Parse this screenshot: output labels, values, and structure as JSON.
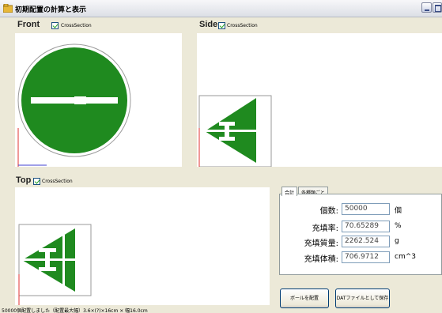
{
  "window": {
    "title": "初期配置の計算と表示"
  },
  "views": {
    "front": {
      "label": "Front",
      "checkbox_label": "CrossSection"
    },
    "side": {
      "label": "Side",
      "checkbox_label": "CrossSection"
    },
    "top": {
      "label": "Top",
      "checkbox_label": "CrossSection"
    }
  },
  "tabs": [
    {
      "label": "合計"
    },
    {
      "label": "各種類ごと"
    }
  ],
  "fields": [
    {
      "label": "個数:",
      "value": "50000",
      "unit": "個"
    },
    {
      "label": "充填率:",
      "value": "70.65289",
      "unit": "%"
    },
    {
      "label": "充填質量:",
      "value": "2262.524",
      "unit": "g"
    },
    {
      "label": "充填体積:",
      "value": "706.9712",
      "unit": "cm^3"
    }
  ],
  "buttons": {
    "place_balls": "ボールを配置",
    "save_dat": "DATファイルとして保存"
  },
  "status": {
    "text": "50000個配置しました（配置最大幅）3.6×(?)×16cm × 幅16.0cm"
  },
  "colors": {
    "shape_fill": "#1f8a1f",
    "window_bg": "#ece9d8",
    "axis_red": "#e03030",
    "axis_blue": "#4040d0"
  }
}
